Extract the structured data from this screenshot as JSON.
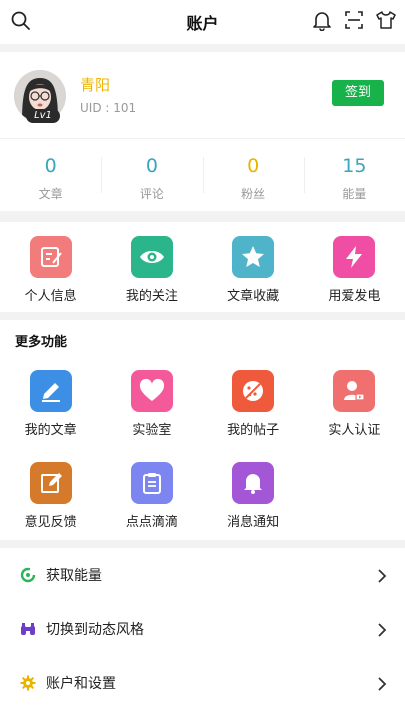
{
  "header": {
    "title": "账户"
  },
  "icons": {
    "search": "search-icon",
    "bell": "bell-icon",
    "scan": "scan-icon",
    "shirt": "shirt-icon"
  },
  "profile": {
    "name": "青阳",
    "uid": "UID : 101",
    "level": "Lv1",
    "signin_label": "签到"
  },
  "stats": [
    {
      "value": "0",
      "label": "文章",
      "color": "#3aa6b9"
    },
    {
      "value": "0",
      "label": "评论",
      "color": "#3aa6b9"
    },
    {
      "value": "0",
      "label": "粉丝",
      "color": "#e8b400"
    },
    {
      "value": "15",
      "label": "能量",
      "color": "#3aa6b9"
    }
  ],
  "quick": [
    {
      "label": "个人信息",
      "color": "#f27b7b",
      "icon": "edit-icon"
    },
    {
      "label": "我的关注",
      "color": "#2bb58a",
      "icon": "eye-icon"
    },
    {
      "label": "文章收藏",
      "color": "#4fb3c9",
      "icon": "star-icon"
    },
    {
      "label": "用爱发电",
      "color": "#f04ea5",
      "icon": "lightning-icon"
    }
  ],
  "more": {
    "title": "更多功能",
    "row1": [
      {
        "label": "我的文章",
        "color": "#3d8fe6",
        "icon": "pen-icon"
      },
      {
        "label": "实验室",
        "color": "#f45a9a",
        "icon": "heart-icon"
      },
      {
        "label": "我的帖子",
        "color": "#f05a3c",
        "icon": "cookie-icon"
      },
      {
        "label": "实人认证",
        "color": "#f07070",
        "icon": "id-card-icon"
      }
    ],
    "row2": [
      {
        "label": "意见反馈",
        "color": "#d57a2a",
        "icon": "feedback-icon"
      },
      {
        "label": "点点滴滴",
        "color": "#7d86f0",
        "icon": "clipboard-icon"
      },
      {
        "label": "消息通知",
        "color": "#a356d6",
        "icon": "bell-icon"
      }
    ]
  },
  "menu": [
    {
      "label": "获取能量",
      "icon": "energy-icon",
      "color": "#2bb55a"
    },
    {
      "label": "切换到动态风格",
      "icon": "binoculars-icon",
      "color": "#6b3fc7"
    },
    {
      "label": "账户和设置",
      "icon": "gear-icon",
      "color": "#e8b400"
    }
  ]
}
